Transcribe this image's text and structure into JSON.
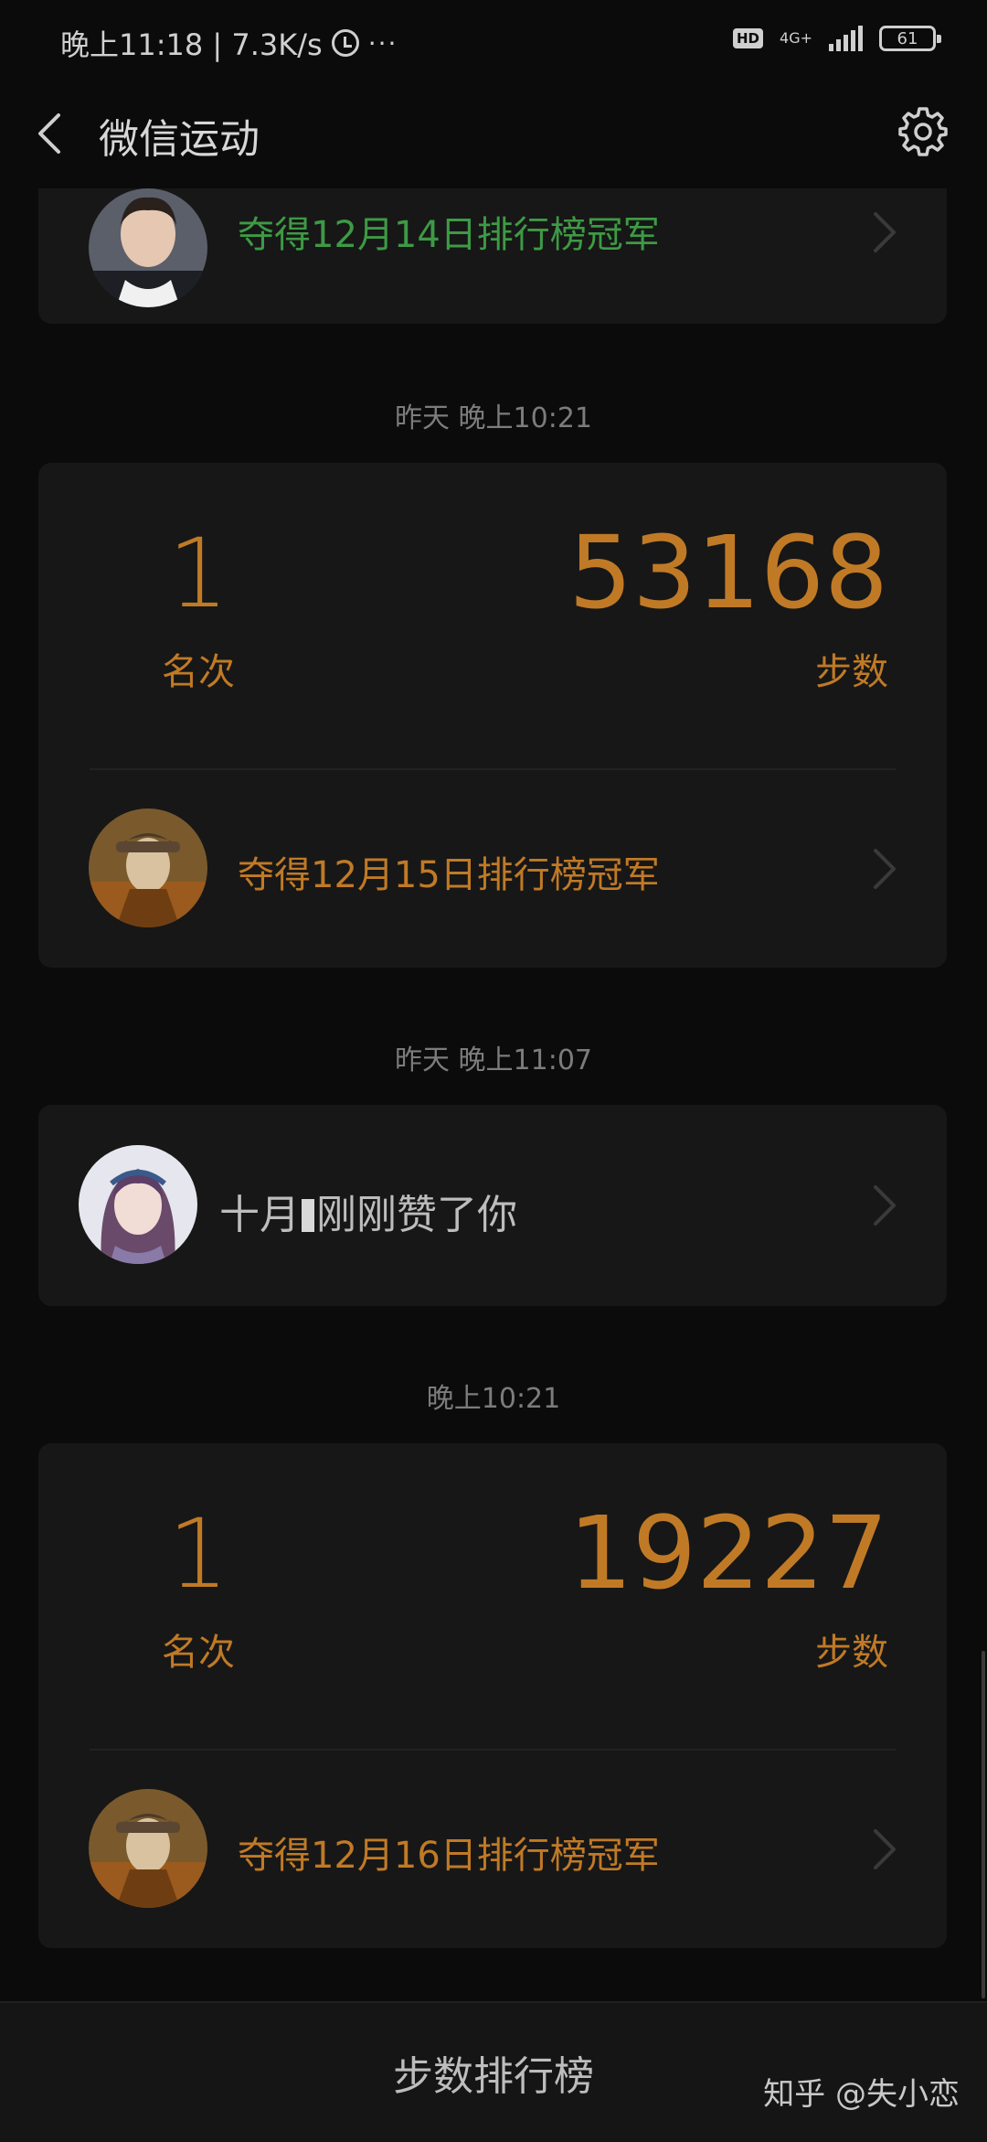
{
  "status_bar": {
    "time_speed": "晚上11:18 | 7.3K/s",
    "dots": "···",
    "hd": "HD",
    "net_type": "4G+",
    "battery": "61"
  },
  "nav": {
    "title": "微信运动"
  },
  "feed": {
    "item1": {
      "champion_text": "夺得12月14日排行榜冠军"
    },
    "item2": {
      "timestamp": "昨天 晚上10:21",
      "rank": "1",
      "rank_label": "名次",
      "steps": "53168",
      "steps_label": "步数",
      "champion_text": "夺得12月15日排行榜冠军"
    },
    "item3": {
      "timestamp": "昨天 晚上11:07",
      "like_name": "十月",
      "like_action": "刚刚赞了你"
    },
    "item4": {
      "timestamp": "晚上10:21",
      "rank": "1",
      "rank_label": "名次",
      "steps": "19227",
      "steps_label": "步数",
      "champion_text": "夺得12月16日排行榜冠军"
    }
  },
  "bottom": {
    "tab_label": "步数排行榜",
    "watermark": "知乎 @失小恋"
  },
  "colors": {
    "accent_orange": "#c07a26",
    "accent_green": "#3e9a45",
    "card_bg": "#171717",
    "page_bg": "#0b0b0b"
  },
  "icons": [
    "back-arrow-icon",
    "gear-icon",
    "alarm-clock-icon",
    "signal-icon",
    "battery-icon",
    "chevron-right-icon"
  ]
}
